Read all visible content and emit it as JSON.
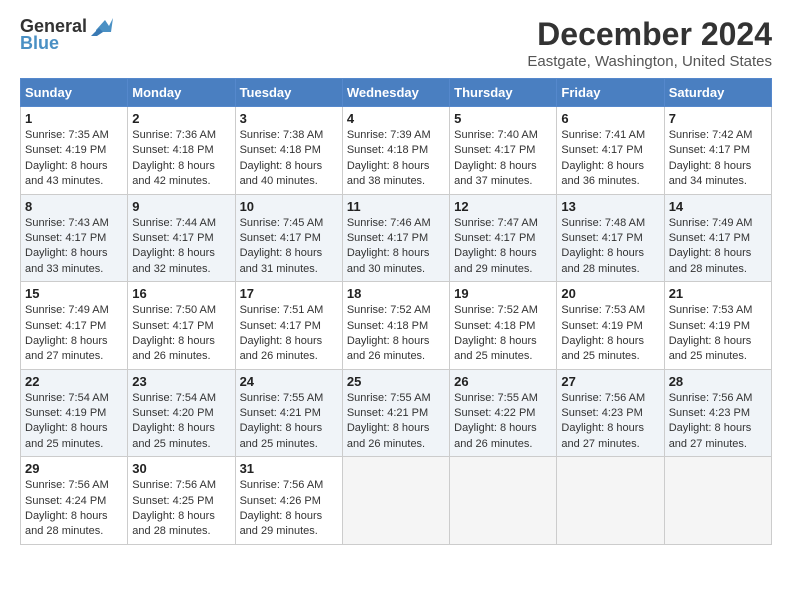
{
  "header": {
    "logo_general": "General",
    "logo_blue": "Blue",
    "month_title": "December 2024",
    "location": "Eastgate, Washington, United States"
  },
  "days_of_week": [
    "Sunday",
    "Monday",
    "Tuesday",
    "Wednesday",
    "Thursday",
    "Friday",
    "Saturday"
  ],
  "weeks": [
    [
      {
        "day": 1,
        "sunrise": "7:35 AM",
        "sunset": "4:19 PM",
        "daylight": "8 hours and 43 minutes."
      },
      {
        "day": 2,
        "sunrise": "7:36 AM",
        "sunset": "4:18 PM",
        "daylight": "8 hours and 42 minutes."
      },
      {
        "day": 3,
        "sunrise": "7:38 AM",
        "sunset": "4:18 PM",
        "daylight": "8 hours and 40 minutes."
      },
      {
        "day": 4,
        "sunrise": "7:39 AM",
        "sunset": "4:18 PM",
        "daylight": "8 hours and 38 minutes."
      },
      {
        "day": 5,
        "sunrise": "7:40 AM",
        "sunset": "4:17 PM",
        "daylight": "8 hours and 37 minutes."
      },
      {
        "day": 6,
        "sunrise": "7:41 AM",
        "sunset": "4:17 PM",
        "daylight": "8 hours and 36 minutes."
      },
      {
        "day": 7,
        "sunrise": "7:42 AM",
        "sunset": "4:17 PM",
        "daylight": "8 hours and 34 minutes."
      }
    ],
    [
      {
        "day": 8,
        "sunrise": "7:43 AM",
        "sunset": "4:17 PM",
        "daylight": "8 hours and 33 minutes."
      },
      {
        "day": 9,
        "sunrise": "7:44 AM",
        "sunset": "4:17 PM",
        "daylight": "8 hours and 32 minutes."
      },
      {
        "day": 10,
        "sunrise": "7:45 AM",
        "sunset": "4:17 PM",
        "daylight": "8 hours and 31 minutes."
      },
      {
        "day": 11,
        "sunrise": "7:46 AM",
        "sunset": "4:17 PM",
        "daylight": "8 hours and 30 minutes."
      },
      {
        "day": 12,
        "sunrise": "7:47 AM",
        "sunset": "4:17 PM",
        "daylight": "8 hours and 29 minutes."
      },
      {
        "day": 13,
        "sunrise": "7:48 AM",
        "sunset": "4:17 PM",
        "daylight": "8 hours and 28 minutes."
      },
      {
        "day": 14,
        "sunrise": "7:49 AM",
        "sunset": "4:17 PM",
        "daylight": "8 hours and 28 minutes."
      }
    ],
    [
      {
        "day": 15,
        "sunrise": "7:49 AM",
        "sunset": "4:17 PM",
        "daylight": "8 hours and 27 minutes."
      },
      {
        "day": 16,
        "sunrise": "7:50 AM",
        "sunset": "4:17 PM",
        "daylight": "8 hours and 26 minutes."
      },
      {
        "day": 17,
        "sunrise": "7:51 AM",
        "sunset": "4:17 PM",
        "daylight": "8 hours and 26 minutes."
      },
      {
        "day": 18,
        "sunrise": "7:52 AM",
        "sunset": "4:18 PM",
        "daylight": "8 hours and 26 minutes."
      },
      {
        "day": 19,
        "sunrise": "7:52 AM",
        "sunset": "4:18 PM",
        "daylight": "8 hours and 25 minutes."
      },
      {
        "day": 20,
        "sunrise": "7:53 AM",
        "sunset": "4:19 PM",
        "daylight": "8 hours and 25 minutes."
      },
      {
        "day": 21,
        "sunrise": "7:53 AM",
        "sunset": "4:19 PM",
        "daylight": "8 hours and 25 minutes."
      }
    ],
    [
      {
        "day": 22,
        "sunrise": "7:54 AM",
        "sunset": "4:19 PM",
        "daylight": "8 hours and 25 minutes."
      },
      {
        "day": 23,
        "sunrise": "7:54 AM",
        "sunset": "4:20 PM",
        "daylight": "8 hours and 25 minutes."
      },
      {
        "day": 24,
        "sunrise": "7:55 AM",
        "sunset": "4:21 PM",
        "daylight": "8 hours and 25 minutes."
      },
      {
        "day": 25,
        "sunrise": "7:55 AM",
        "sunset": "4:21 PM",
        "daylight": "8 hours and 26 minutes."
      },
      {
        "day": 26,
        "sunrise": "7:55 AM",
        "sunset": "4:22 PM",
        "daylight": "8 hours and 26 minutes."
      },
      {
        "day": 27,
        "sunrise": "7:56 AM",
        "sunset": "4:23 PM",
        "daylight": "8 hours and 27 minutes."
      },
      {
        "day": 28,
        "sunrise": "7:56 AM",
        "sunset": "4:23 PM",
        "daylight": "8 hours and 27 minutes."
      }
    ],
    [
      {
        "day": 29,
        "sunrise": "7:56 AM",
        "sunset": "4:24 PM",
        "daylight": "8 hours and 28 minutes."
      },
      {
        "day": 30,
        "sunrise": "7:56 AM",
        "sunset": "4:25 PM",
        "daylight": "8 hours and 28 minutes."
      },
      {
        "day": 31,
        "sunrise": "7:56 AM",
        "sunset": "4:26 PM",
        "daylight": "8 hours and 29 minutes."
      },
      null,
      null,
      null,
      null
    ]
  ]
}
